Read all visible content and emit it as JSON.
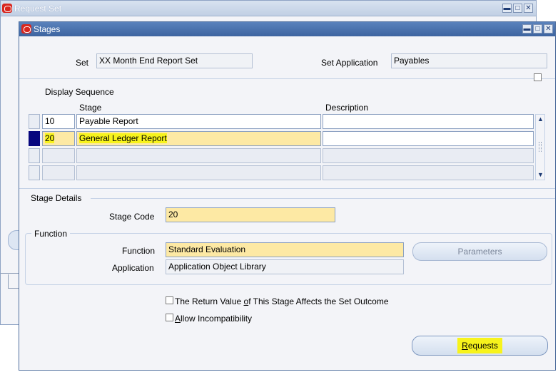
{
  "background_window": {
    "title": "Request Set"
  },
  "window": {
    "title": "Stages",
    "controls": {
      "minimize": "▬",
      "maximize": "□",
      "close": "✕"
    }
  },
  "header": {
    "set_label": "Set",
    "set_value": "XX Month End Report Set",
    "set_application_label": "Set Application",
    "set_application_value": "Payables"
  },
  "table": {
    "display_sequence_label": "Display Sequence",
    "columns": {
      "stage": "Stage",
      "description": "Description"
    },
    "rows": [
      {
        "seq": "10",
        "stage": "Payable Report",
        "description": ""
      },
      {
        "seq": "20",
        "stage": "General Ledger Report",
        "description": ""
      },
      {
        "seq": "",
        "stage": "",
        "description": ""
      },
      {
        "seq": "",
        "stage": "",
        "description": ""
      }
    ]
  },
  "stage_details": {
    "section_label": "Stage Details",
    "stage_code_label": "Stage Code",
    "stage_code_value": "20"
  },
  "function": {
    "section_label": "Function",
    "function_label": "Function",
    "function_value": "Standard Evaluation",
    "application_label": "Application",
    "application_value": "Application Object Library",
    "parameters_button": "Parameters"
  },
  "options": {
    "return_value_prefix": "The Return Value ",
    "return_value_mnemonic": "o",
    "return_value_suffix": "f This Stage Affects the Set Outcome",
    "allow_mnemonic": "A",
    "allow_rest": "llow Incompatibility"
  },
  "footer": {
    "requests_mnemonic": "R",
    "requests_rest": "equests"
  },
  "colors": {
    "title_bar": "#3d64a0",
    "selected_field": "#fde9a4",
    "highlight": "#f7f31c",
    "row_indicator": "#06067e"
  }
}
